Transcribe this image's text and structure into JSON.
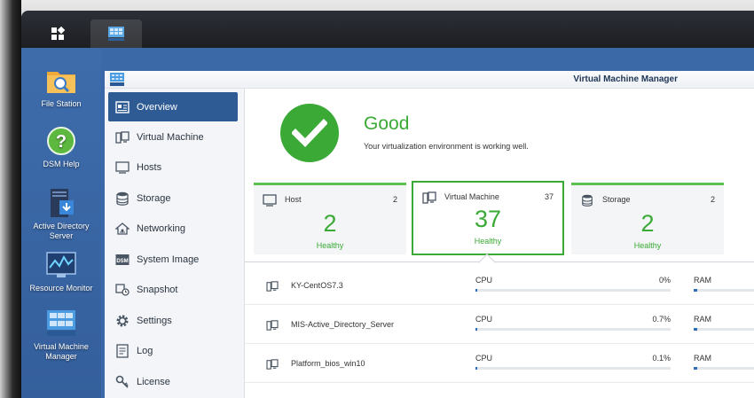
{
  "desktop": {
    "icons": [
      {
        "label": "File Station",
        "icon": "folder-search-icon"
      },
      {
        "label": "DSM Help",
        "icon": "help-icon"
      },
      {
        "label": "Active Directory Server",
        "icon": "active-directory-icon"
      },
      {
        "label": "Resource Monitor",
        "icon": "resource-monitor-icon"
      },
      {
        "label": "Virtual Machine Manager",
        "icon": "vmm-icon"
      }
    ]
  },
  "window": {
    "title": "Virtual Machine Manager"
  },
  "sidebar": {
    "items": [
      {
        "label": "Overview",
        "icon": "overview-icon",
        "active": true
      },
      {
        "label": "Virtual Machine",
        "icon": "virtual-machine-icon"
      },
      {
        "label": "Hosts",
        "icon": "host-icon"
      },
      {
        "label": "Storage",
        "icon": "storage-icon"
      },
      {
        "label": "Networking",
        "icon": "networking-icon"
      },
      {
        "label": "System Image",
        "icon": "system-image-icon"
      },
      {
        "label": "Snapshot",
        "icon": "snapshot-icon"
      },
      {
        "label": "Settings",
        "icon": "gear-icon"
      },
      {
        "label": "Log",
        "icon": "log-icon"
      },
      {
        "label": "License",
        "icon": "key-icon"
      }
    ]
  },
  "status": {
    "title": "Good",
    "message": "Your virtualization environment is working well."
  },
  "cards": [
    {
      "title": "Host",
      "count": "2",
      "big": "2",
      "status": "Healthy",
      "icon": "host-icon"
    },
    {
      "title": "Virtual Machine",
      "count": "37",
      "big": "37",
      "status": "Healthy",
      "icon": "virtual-machine-icon"
    },
    {
      "title": "Storage",
      "count": "2",
      "big": "2",
      "status": "Healthy",
      "icon": "storage-icon"
    }
  ],
  "vm_list": {
    "cpu_label": "CPU",
    "ram_label": "RAM",
    "rows": [
      {
        "name": "KY-CentOS7.3",
        "cpu": "0%",
        "cpu_fraction": 0.0
      },
      {
        "name": "MIS-Active_Directory_Server",
        "cpu": "0.7%",
        "cpu_fraction": 0.007
      },
      {
        "name": "Platform_bios_win10",
        "cpu": "0.1%",
        "cpu_fraction": 0.001
      }
    ]
  },
  "colors": {
    "accent_green": "#3aa935",
    "nav_active": "#2f5b94",
    "desktop_blue": "#3b69a8"
  }
}
